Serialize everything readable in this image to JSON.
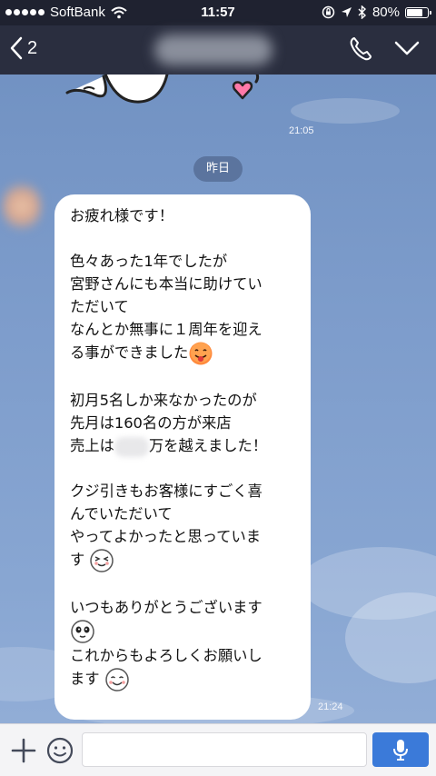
{
  "status_bar": {
    "carrier": "SoftBank",
    "time": "11:57",
    "battery": "80%",
    "battery_level": 0.8
  },
  "header": {
    "unread_count": "2"
  },
  "chat": {
    "sticker_time": "21:05",
    "date_label": "昨日",
    "message": {
      "line_1": "お疲れ様です！",
      "line_2": "色々あった1年でしたが",
      "line_3": "宮野さんにも本当に助けてい",
      "line_4": "ただいて",
      "line_5": "なんとか無事に１周年を迎え",
      "line_6": "る事ができました",
      "line_7": "初月5名しか来なかったのが",
      "line_8": "先月は160名の方が来店",
      "line_9a": "売上は",
      "line_9b": "万を越えました！",
      "line_10": "クジ引きもお客様にすごく喜",
      "line_11": "んでいただいて",
      "line_12": "やってよかったと思っていま",
      "line_13": "す",
      "line_14": "いつもありがとうございます",
      "line_15": "これからもよろしくお願いし",
      "line_16": "ます",
      "time": "21:24"
    }
  },
  "colors": {
    "header_bg": "#2a2e3f",
    "status_bg": "#1f2230",
    "accent": "#3b7ad9"
  },
  "icons": [
    "wifi-icon",
    "lock-rotation-icon",
    "location-icon",
    "bluetooth-icon",
    "battery-icon",
    "back-chevron-icon",
    "phone-icon",
    "dropdown-chevron-icon",
    "plus-icon",
    "emoji-icon",
    "mic-icon"
  ]
}
